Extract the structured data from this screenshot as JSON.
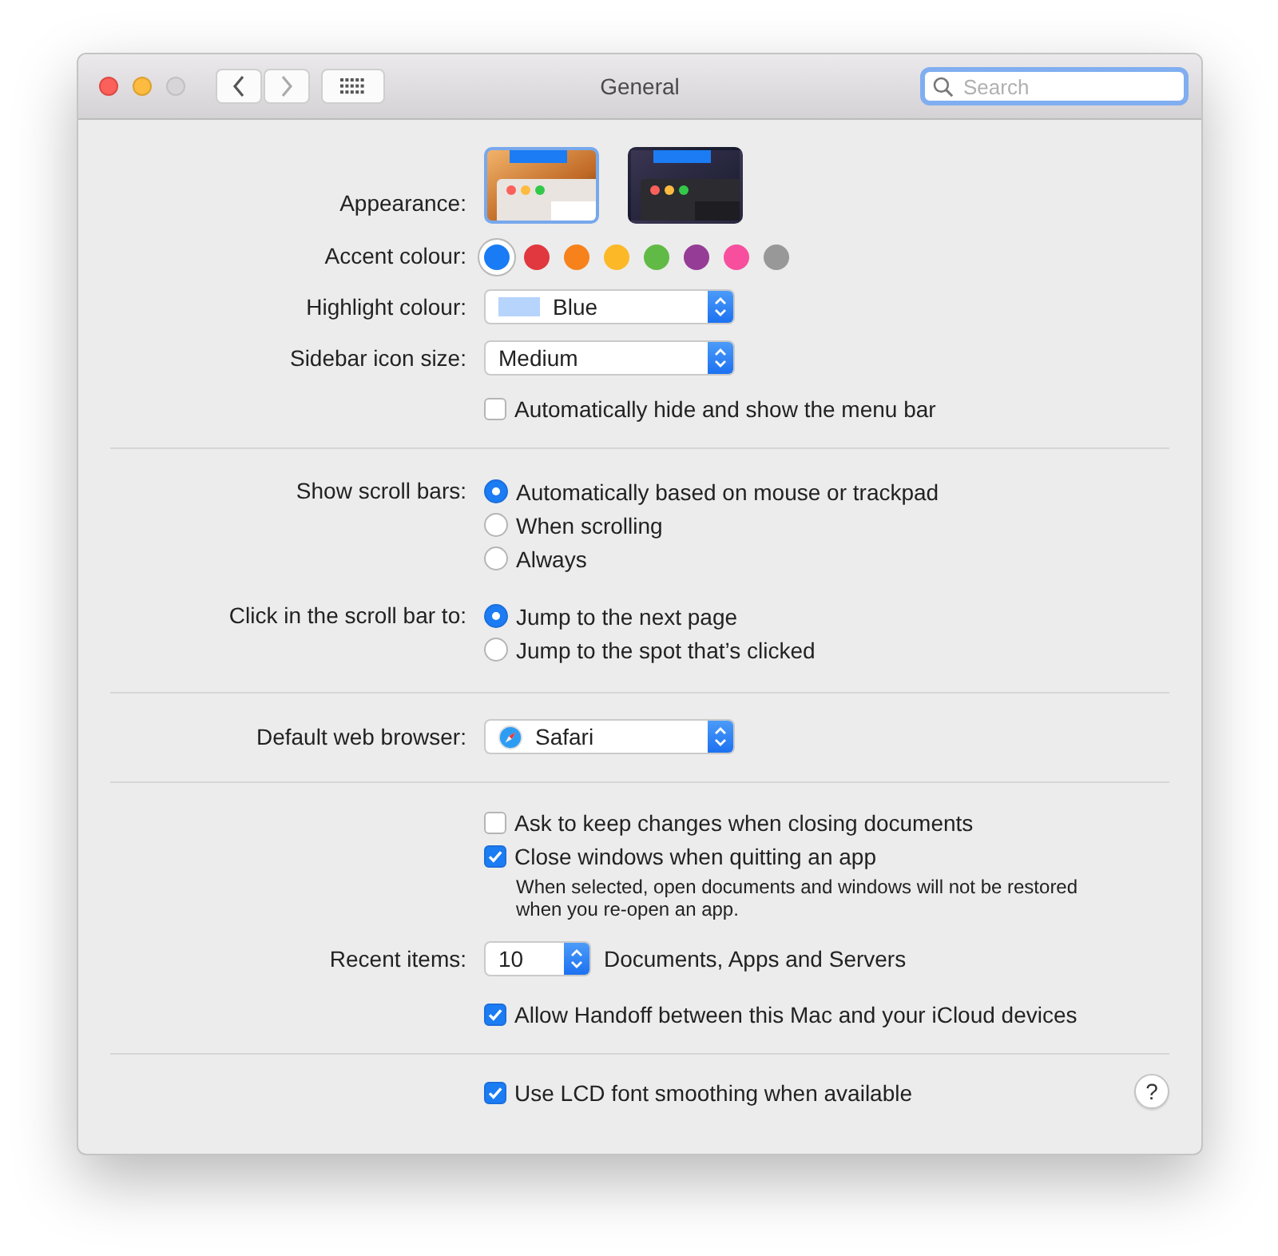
{
  "window": {
    "title": "General",
    "search": {
      "placeholder": "Search"
    }
  },
  "sections": [
    {
      "rows": [
        {
          "kind": "appearance",
          "label": "Appearance:",
          "options": [
            {
              "kind": "light",
              "selected": true
            },
            {
              "kind": "dark",
              "selected": false
            }
          ]
        },
        {
          "kind": "swatches",
          "label": "Accent colour:",
          "options": [
            {
              "color": "#1a7cf4",
              "selected": true
            },
            {
              "color": "#e0383e",
              "selected": false
            },
            {
              "color": "#f7821b",
              "selected": false
            },
            {
              "color": "#fcb827",
              "selected": false
            },
            {
              "color": "#62ba46",
              "selected": false
            },
            {
              "color": "#953d96",
              "selected": false
            },
            {
              "color": "#f74f9e",
              "selected": false
            },
            {
              "color": "#989898",
              "selected": false
            }
          ]
        },
        {
          "kind": "popup",
          "label": "Highlight colour:",
          "value": "Blue",
          "color": "#b6d4fc"
        },
        {
          "kind": "popup",
          "label": "Sidebar icon size:",
          "value": "Medium"
        },
        {
          "kind": "checkbox",
          "text": "Automatically hide and show the menu bar",
          "checked": false
        }
      ]
    },
    {
      "rows": [
        {
          "kind": "radios",
          "label": "Show scroll bars:",
          "options": [
            {
              "text": "Automatically based on mouse or trackpad",
              "selected": true
            },
            {
              "text": "When scrolling",
              "selected": false
            },
            {
              "text": "Always",
              "selected": false
            }
          ]
        },
        {
          "kind": "radios",
          "label": "Click in the scroll bar to:",
          "options": [
            {
              "text": "Jump to the next page",
              "selected": true
            },
            {
              "text": "Jump to the spot that’s clicked",
              "selected": false
            }
          ]
        }
      ]
    },
    {
      "rows": [
        {
          "kind": "browser_popup",
          "label": "Default web browser:",
          "value": "Safari"
        }
      ]
    },
    {
      "rows": [
        {
          "kind": "checkbox",
          "text": "Ask to keep changes when closing documents",
          "checked": false
        },
        {
          "kind": "checkbox",
          "text": "Close windows when quitting an app",
          "checked": true,
          "note": "When selected, open documents and windows will not be restored when you re-open an app."
        },
        {
          "kind": "stepper",
          "label": "Recent items:",
          "value": "10",
          "suffix": "Documents, Apps and Servers"
        },
        {
          "kind": "checkbox",
          "text": "Allow Handoff between this Mac and your iCloud devices",
          "checked": true
        }
      ]
    },
    {
      "rows": [
        {
          "kind": "checkbox",
          "text": "Use LCD font smoothing when available",
          "checked": true
        }
      ],
      "help": "?"
    }
  ]
}
